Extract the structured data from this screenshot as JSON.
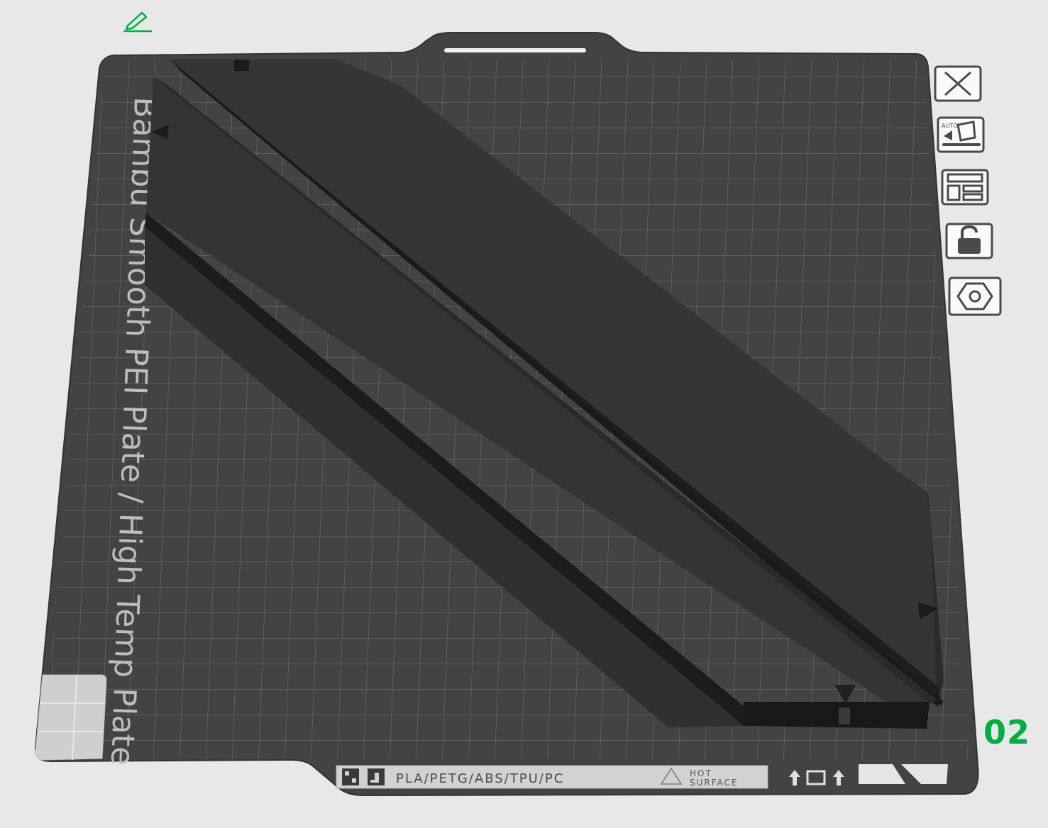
{
  "plate": {
    "label": "Bambu Smooth PEI Plate / High Temp Plate",
    "materials": "PLA/PETG/ABS/TPU/PC",
    "hot_surface_line1": "HOT",
    "hot_surface_line2": "SURFACE",
    "number": "02",
    "accent_color": "#00ae42",
    "bed_color": "#464646",
    "object_color": "#333333"
  },
  "toolbar": {
    "items": [
      {
        "name": "remove-plate",
        "icon": "close-icon"
      },
      {
        "name": "auto-orient",
        "icon": "auto-orient-icon",
        "text": "AUTO"
      },
      {
        "name": "arrange",
        "icon": "arrange-icon"
      },
      {
        "name": "lock-plate",
        "icon": "unlock-icon"
      },
      {
        "name": "plate-settings",
        "icon": "hex-settings-icon"
      }
    ]
  },
  "header": {
    "edit_icon": "pencil-icon"
  }
}
